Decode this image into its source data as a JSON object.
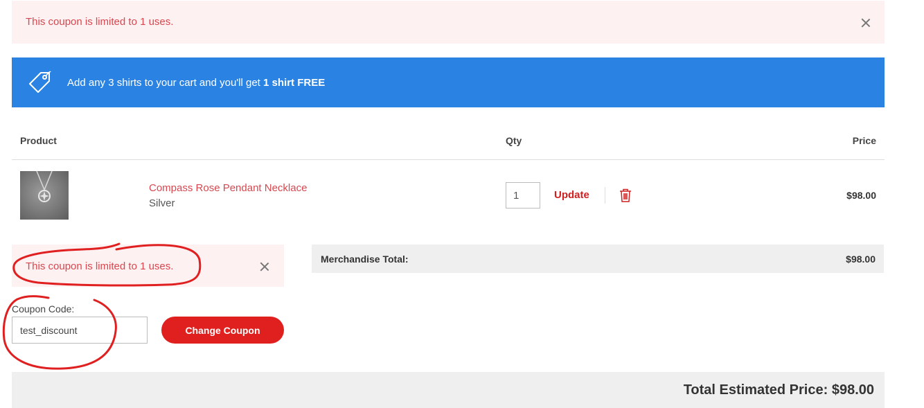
{
  "top_alert": {
    "message": "This coupon is limited to 1 uses."
  },
  "promo_banner": {
    "icon": "tag-icon",
    "text": "Add any 3 shirts to your cart and you'll get ",
    "bold_text": "1 shirt FREE"
  },
  "cart_table": {
    "headers": {
      "product": "Product",
      "qty": "Qty",
      "price": "Price"
    },
    "items": [
      {
        "thumbnail_icon": "necklace-thumbnail",
        "name": "Compass Rose Pendant Necklace",
        "variant": "Silver",
        "qty": "1",
        "update_label": "Update",
        "delete_icon": "trash-icon",
        "price": "$98.00"
      }
    ]
  },
  "coupon_alert": {
    "message": "This coupon is limited to 1 uses."
  },
  "merchandise": {
    "label": "Merchandise Total:",
    "value": "$98.00"
  },
  "coupon": {
    "label": "Coupon Code:",
    "value": "test_discount",
    "button_label": "Change Coupon"
  },
  "total": {
    "text": "Total Estimated Price: $98.00"
  },
  "colors": {
    "accent_red": "#e0201f",
    "promo_blue": "#2a83e3",
    "alert_bg": "#fdf1f2",
    "alert_text": "#d8474f",
    "annotation_red": "#e02020"
  }
}
